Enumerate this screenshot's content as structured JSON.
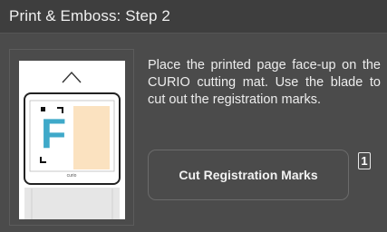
{
  "header": {
    "title": "Print & Emboss: Step 2"
  },
  "instructions": {
    "text": "Place the printed page face-up on the CURIO cutting mat. Use the blade to cut out the registration marks."
  },
  "actions": {
    "cut_registration_label": "Cut Registration Marks"
  },
  "step_badge": {
    "value": "1"
  },
  "mat_preview": {
    "letter": "F",
    "brand": "curio",
    "colors": {
      "letter": "#3fa9c9",
      "panel": "#fbe2c0",
      "mark": "#111111"
    }
  }
}
